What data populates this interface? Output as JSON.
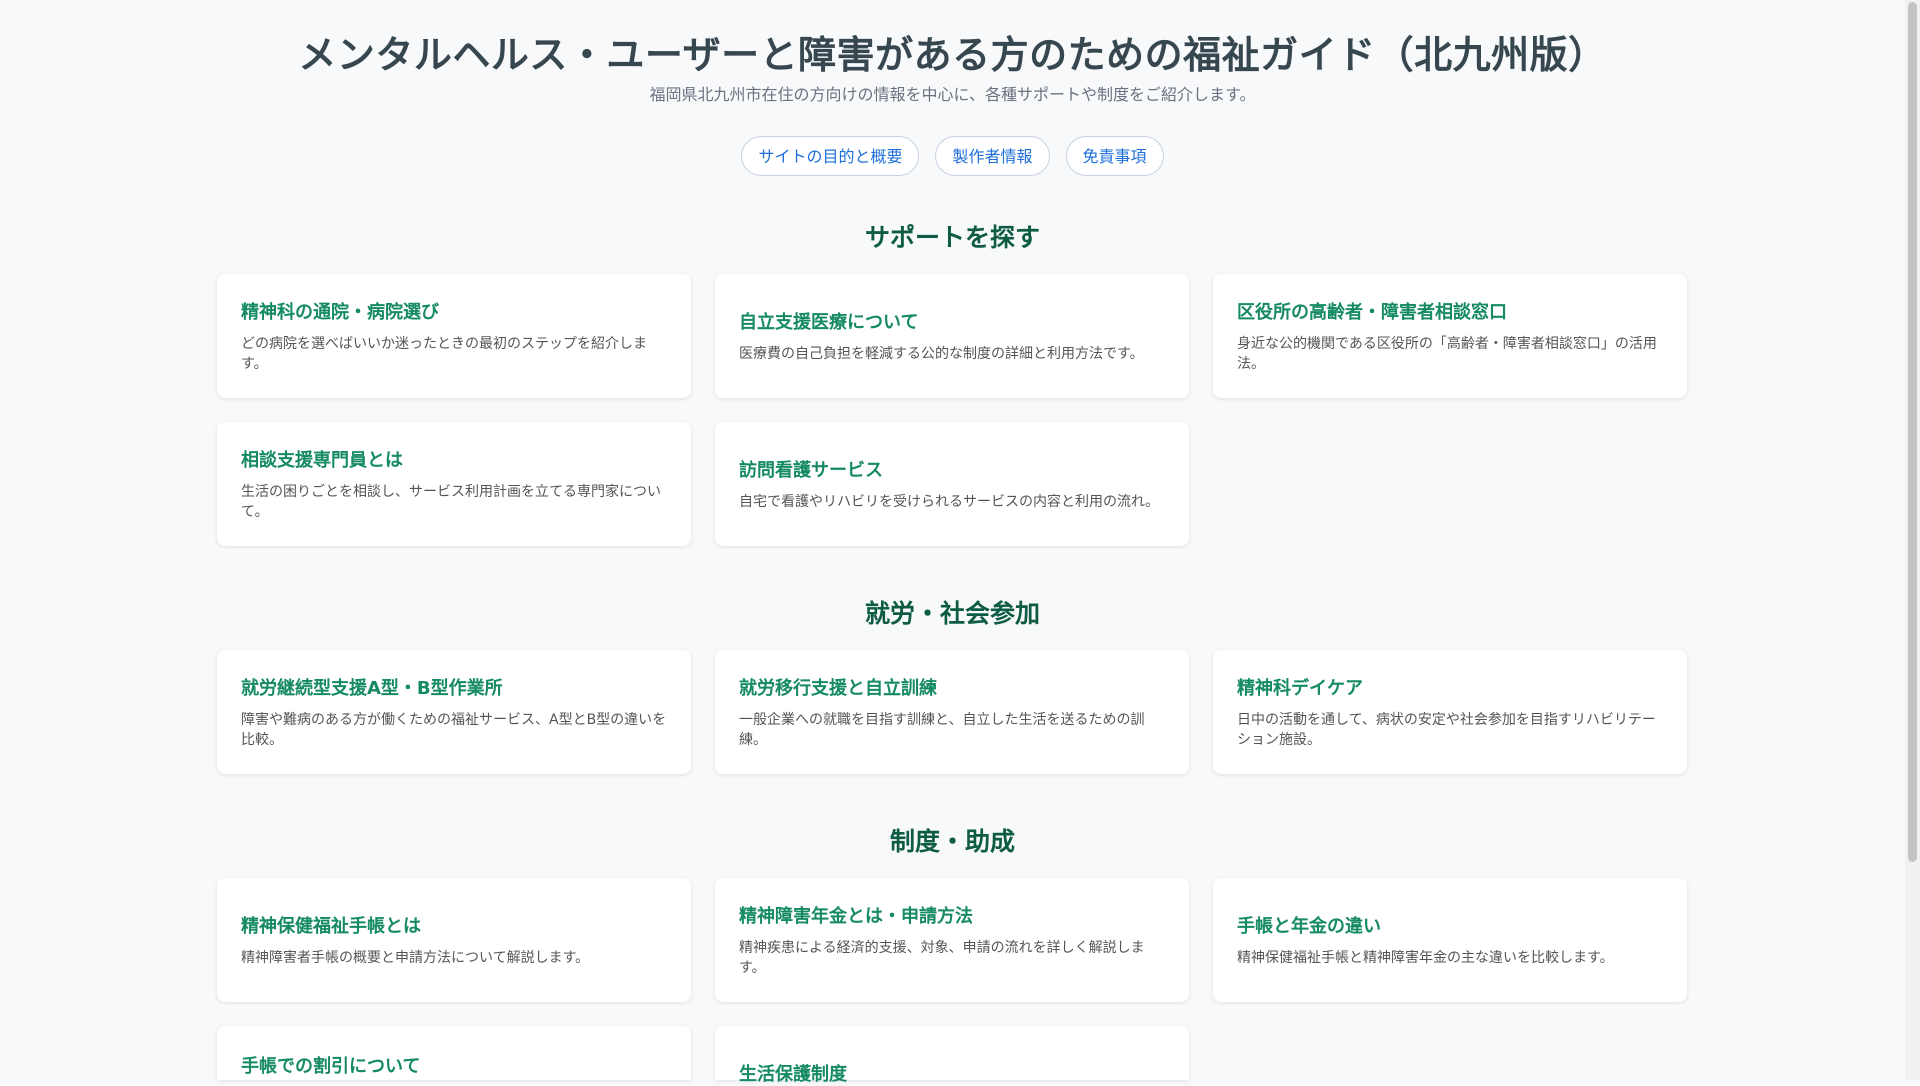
{
  "header": {
    "title": "メンタルヘルス・ユーザーと障害がある方のための福祉ガイド（北九州版）",
    "subtitle": "福岡県北九州市在住の方向けの情報を中心に、各種サポートや制度をご紹介します。"
  },
  "nav": {
    "items": [
      {
        "label": "サイトの目的と概要"
      },
      {
        "label": "製作者情報"
      },
      {
        "label": "免責事項"
      }
    ]
  },
  "sections": [
    {
      "title": "サポートを探す",
      "cards": [
        {
          "title": "精神科の通院・病院選び",
          "desc": "どの病院を選べばいいか迷ったときの最初のステップを紹介します。"
        },
        {
          "title": "自立支援医療について",
          "desc": "医療費の自己負担を軽減する公的な制度の詳細と利用方法です。"
        },
        {
          "title": "区役所の高齢者・障害者相談窓口",
          "desc": "身近な公的機関である区役所の「高齢者・障害者相談窓口」の活用法。"
        },
        {
          "title": "相談支援専門員とは",
          "desc": "生活の困りごとを相談し、サービス利用計画を立てる専門家について。"
        },
        {
          "title": "訪問看護サービス",
          "desc": "自宅で看護やリハビリを受けられるサービスの内容と利用の流れ。"
        }
      ]
    },
    {
      "title": "就労・社会参加",
      "cards": [
        {
          "title": "就労継続型支援A型・B型作業所",
          "desc": "障害や難病のある方が働くための福祉サービス、A型とB型の違いを比較。"
        },
        {
          "title": "就労移行支援と自立訓練",
          "desc": "一般企業への就職を目指す訓練と、自立した生活を送るための訓練。"
        },
        {
          "title": "精神科デイケア",
          "desc": "日中の活動を通して、病状の安定や社会参加を目指すリハビリテーション施設。"
        }
      ]
    },
    {
      "title": "制度・助成",
      "cards": [
        {
          "title": "精神保健福祉手帳とは",
          "desc": "精神障害者手帳の概要と申請方法について解説します。"
        },
        {
          "title": "精神障害年金とは・申請方法",
          "desc": "精神疾患による経済的支援、対象、申請の流れを詳しく解説します。"
        },
        {
          "title": "手帳と年金の違い",
          "desc": "精神保健福祉手帳と精神障害年金の主な違いを比較します。"
        },
        {
          "title": "手帳での割引について",
          "desc": ""
        },
        {
          "title": "生活保護制度",
          "desc": ""
        }
      ]
    }
  ]
}
